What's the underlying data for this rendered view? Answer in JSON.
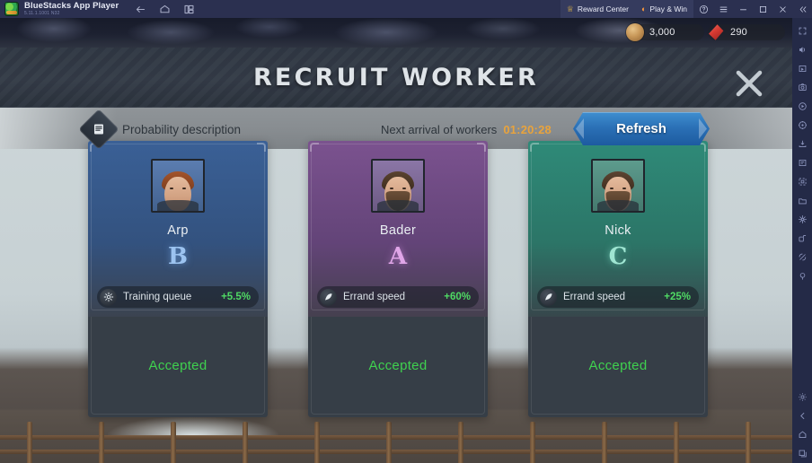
{
  "emulator": {
    "app_name": "BlueStacks App Player",
    "app_sub": "5.11.1.1001 N32",
    "nav": [
      {
        "name": "back-icon",
        "label": "Back"
      },
      {
        "name": "home-icon",
        "label": "Home"
      },
      {
        "name": "recent-apps-icon",
        "label": "Recent apps"
      }
    ],
    "reward_center_label": "Reward Center",
    "play_win_label": "Play & Win",
    "window_buttons": [
      {
        "name": "help-icon",
        "label": "Help"
      },
      {
        "name": "menu-icon",
        "label": "Menu"
      },
      {
        "name": "minimize-icon",
        "label": "Minimize"
      },
      {
        "name": "maximize-icon",
        "label": "Maximize"
      },
      {
        "name": "close-icon",
        "label": "Close"
      },
      {
        "name": "collapse-sidebar-icon",
        "label": "Collapse"
      }
    ],
    "sidebar_icons": [
      "fullscreen-icon",
      "volume-icon",
      "keymapping-icon",
      "screenshot-icon",
      "record-screen-icon",
      "location-icon",
      "install-apk-icon",
      "macro-icon",
      "multi-instance-icon",
      "media-manager-icon",
      "eco-mode-icon",
      "rotate-icon",
      "shake-icon",
      "pin-icon"
    ],
    "sidebar_bottom_icons": [
      "settings-icon",
      "back-icon",
      "home-icon",
      "recent-apps-icon"
    ]
  },
  "currency": [
    {
      "icon": "gold-coin-icon",
      "value": "3,000"
    },
    {
      "icon": "ruby-gem-icon",
      "value": "290"
    }
  ],
  "modal": {
    "title": "RECRUIT WORKER",
    "close_label": "Close",
    "probability": {
      "icon": "scroll-icon",
      "label": "Probability description"
    },
    "timer": {
      "label": "Next arrival of workers",
      "value": "01:20:28",
      "value_color": "#e8a33d"
    },
    "refresh_label": "Refresh",
    "refresh_color": "#2a6fb5"
  },
  "workers": [
    {
      "name": "Arp",
      "grade": "B",
      "theme": "c-blue",
      "accent": "#3a6096",
      "trait": {
        "icon": "training-queue-icon",
        "name": "Training queue",
        "value": "+5.5%"
      },
      "status": "Accepted",
      "status_color": "#3fd14f",
      "portrait": "female-redhead-portrait"
    },
    {
      "name": "Bader",
      "grade": "A",
      "theme": "c-purp",
      "accent": "#7b528f",
      "trait": {
        "icon": "errand-speed-icon",
        "name": "Errand speed",
        "value": "+60%"
      },
      "status": "Accepted",
      "status_color": "#3fd14f",
      "portrait": "bearded-man-portrait"
    },
    {
      "name": "Nick",
      "grade": "C",
      "theme": "c-teal",
      "accent": "#2e8a78",
      "trait": {
        "icon": "errand-speed-icon",
        "name": "Errand speed",
        "value": "+25%"
      },
      "status": "Accepted",
      "status_color": "#3fd14f",
      "portrait": "bearded-man-portrait"
    }
  ]
}
